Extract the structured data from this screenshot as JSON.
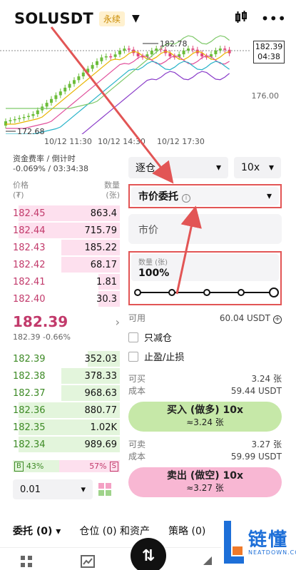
{
  "header": {
    "symbol": "SOLUSDT",
    "badge": "永续",
    "caret": "▼",
    "chart_icon": "candlestick-icon",
    "more": "•••"
  },
  "chart": {
    "current_price": "182.39",
    "countdown": "04:38",
    "high_label": "182.78",
    "low_label": "172.68",
    "level": "176.00",
    "x_ticks": [
      "10/12 11:30",
      "10/12 14:30",
      "10/12 17:30"
    ]
  },
  "book": {
    "funding_label": "资金费率 / 倒计时",
    "funding_value": "-0.069% / 03:34:38",
    "col_price": "价格",
    "col_price_unit": "(₮)",
    "col_qty": "数量",
    "col_qty_unit": "(张)",
    "asks": [
      {
        "price": "182.45",
        "qty": "863.4",
        "depth": 0.95
      },
      {
        "price": "182.44",
        "qty": "715.79",
        "depth": 0.95
      },
      {
        "price": "182.43",
        "qty": "185.22",
        "depth": 0.55
      },
      {
        "price": "182.42",
        "qty": "68.17",
        "depth": 0.55
      },
      {
        "price": "182.41",
        "qty": "1.81",
        "depth": 0.2
      },
      {
        "price": "182.40",
        "qty": "30.3",
        "depth": 0.2
      }
    ],
    "last_price": "182.39",
    "last_sub": "182.39  -0.66%",
    "last_arrow": "›",
    "bids": [
      {
        "price": "182.39",
        "qty": "352.03",
        "depth": 0.3
      },
      {
        "price": "182.38",
        "qty": "378.33",
        "depth": 0.55
      },
      {
        "price": "182.37",
        "qty": "968.63",
        "depth": 0.55
      },
      {
        "price": "182.36",
        "qty": "880.77",
        "depth": 0.95
      },
      {
        "price": "182.35",
        "qty": "1.02K",
        "depth": 0.95
      },
      {
        "price": "182.34",
        "qty": "989.69",
        "depth": 0.95
      }
    ],
    "buy_box": "B",
    "buy_pct": "43%",
    "sell_box": "S",
    "sell_pct": "57%",
    "buy_ratio": 0.43,
    "precision": "0.01",
    "precision_caret": "▾"
  },
  "panel": {
    "margin_mode": "逐仓",
    "leverage": "10x",
    "caret": "▾",
    "order_type": "市价委托",
    "info": "i",
    "order_caret": "▾",
    "price_field": "市价",
    "qty_label": "数量 (张)",
    "qty_value": "100%",
    "qty_percent": 100,
    "available_label": "可用",
    "available_value": "60.04 USDT",
    "available_plus": "+",
    "reduce_only": "只减仓",
    "tp_sl": "止盈/止损",
    "can_buy_label": "可买",
    "can_buy_value": "3.24 张",
    "buy_cost_label": "成本",
    "buy_cost_value": "59.44 USDT",
    "buy_button": "买入 (做多) 10x",
    "buy_button_sub": "≈3.24 张",
    "can_sell_label": "可卖",
    "can_sell_value": "3.27 张",
    "sell_cost_label": "成本",
    "sell_cost_value": "59.99 USDT",
    "sell_button": "卖出 (做空) 10x",
    "sell_button_sub": "≈3.27 张"
  },
  "tabs": {
    "orders": "委托 (0)",
    "orders_caret": "▾",
    "positions": "仓位 (0) 和资产",
    "strategy": "策略 (0)"
  },
  "nav": {
    "fab": "⇅"
  },
  "watermark": {
    "title": "链懂",
    "subtitle": "NEATDOWN.COM"
  },
  "colors": {
    "ask": "#c23a6b",
    "bid": "#3d8a25",
    "annotation": "#e25555",
    "buy_button": "#c6e8a8",
    "sell_button": "#f8b7d3"
  }
}
